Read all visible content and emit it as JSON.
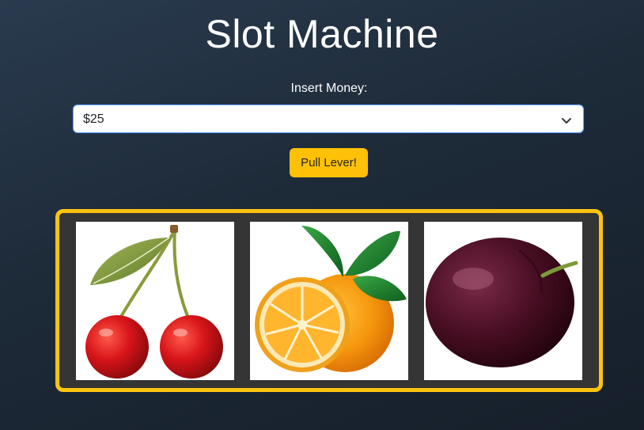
{
  "app": {
    "title": "Slot Machine"
  },
  "money": {
    "label": "Insert Money:",
    "selected": "$25"
  },
  "lever": {
    "label": "Pull Lever!"
  },
  "reels": [
    {
      "symbol": "cherry-icon"
    },
    {
      "symbol": "orange-icon"
    },
    {
      "symbol": "plum-icon"
    }
  ],
  "colors": {
    "accent": "#ffc107",
    "reel_border": "#ffc30f",
    "reel_bg": "#353535"
  }
}
